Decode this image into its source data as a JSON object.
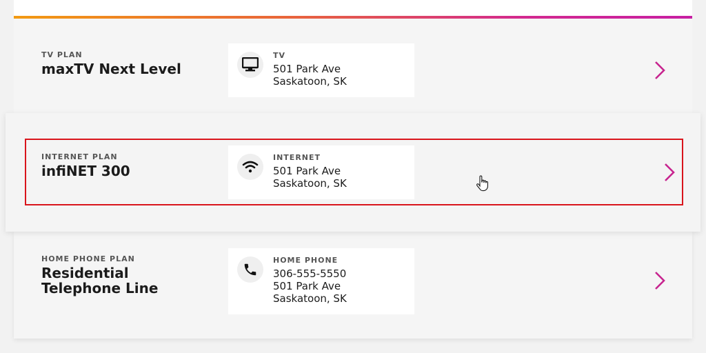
{
  "accent_color": "#c7248f",
  "focus_color": "#d9141b",
  "plans": [
    {
      "plan_label": "TV PLAN",
      "plan_name": "maxTV Next Level",
      "service_icon": "tv-monitor-icon",
      "service_label": "TV",
      "service_lines": [
        "501 Park Ave",
        "Saskatoon, SK"
      ]
    },
    {
      "plan_label": "INTERNET PLAN",
      "plan_name": "infiNET 300",
      "service_icon": "wifi-icon",
      "service_label": "INTERNET",
      "service_lines": [
        "501 Park Ave",
        "Saskatoon, SK"
      ]
    },
    {
      "plan_label": "HOME PHONE PLAN",
      "plan_name_lines": [
        "Residential",
        "Telephone Line"
      ],
      "service_icon": "phone-icon",
      "service_label": "HOME PHONE",
      "service_lines": [
        "306-555-5550",
        "501 Park Ave",
        "Saskatoon, SK"
      ]
    }
  ]
}
